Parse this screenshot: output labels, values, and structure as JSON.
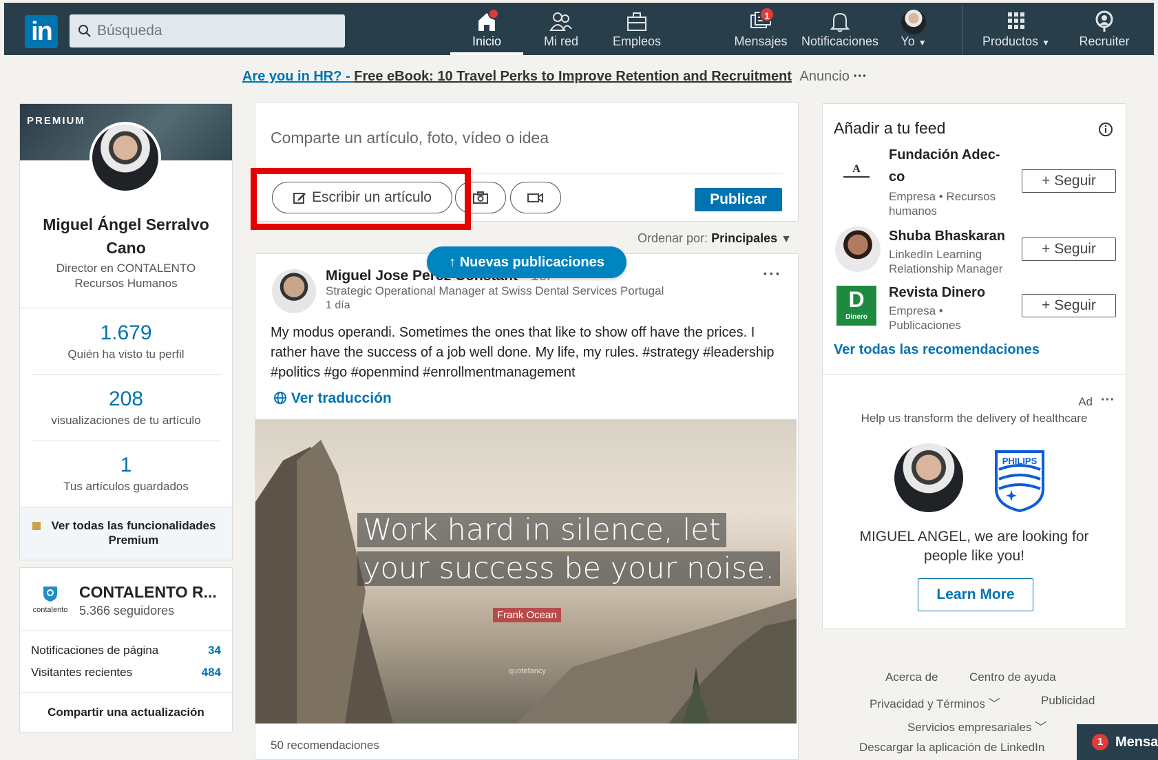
{
  "nav": {
    "logo": "in",
    "search_placeholder": "Búsqueda",
    "items": [
      {
        "label": "Inicio",
        "icon": "home-icon"
      },
      {
        "label": "Mi red",
        "icon": "network-icon"
      },
      {
        "label": "Empleos",
        "icon": "briefcase-icon"
      },
      {
        "label": "Mensajes",
        "icon": "messages-icon",
        "badge": "1"
      },
      {
        "label": "Notificaciones",
        "icon": "bell-icon"
      },
      {
        "label": "Yo",
        "icon": "avatar"
      },
      {
        "label": "Productos",
        "icon": "grid-icon"
      },
      {
        "label": "Recruiter",
        "icon": "recruiter-icon"
      }
    ]
  },
  "ad": {
    "link": "Are you in HR? - ",
    "title": "Free eBook: 10 Travel Perks to Improve Retention and Recruitment",
    "label": "Anuncio",
    "more": "···"
  },
  "profile": {
    "premium": "PREMIUM",
    "name_line1": "Miguel Ángel Serralvo",
    "name_line2": "Cano",
    "title_line1": "Director en CONTALENTO",
    "title_line2": "Recursos Humanos",
    "stats": [
      {
        "value": "1.679",
        "label": "Quién ha visto tu perfil"
      },
      {
        "value": "208",
        "label": "visualizaciones de tu artículo"
      },
      {
        "value": "1",
        "label": "Tus artículos guardados"
      }
    ],
    "premium_link_line1": "Ver todas las funcionalidades",
    "premium_link_line2": "Premium"
  },
  "company": {
    "name": "CONTALENTO R...",
    "followers": "5.366 seguidores",
    "logo_text": "contalento",
    "rows": [
      {
        "label": "Notificaciones de página",
        "value": "34"
      },
      {
        "label": "Visitantes recientes",
        "value": "484"
      }
    ],
    "share": "Compartir una actualización"
  },
  "share": {
    "placeholder": "Comparte un artículo, foto, vídeo o idea",
    "write_article": "Escribir un artículo",
    "publish": "Publicar"
  },
  "sort": {
    "label": "Ordenar por: ",
    "value": "Principales"
  },
  "new_posts": "Nuevas publicaciones",
  "post": {
    "author": "Miguel Jose Perez Constant",
    "degree": " • 1er",
    "role": "Strategic Operational Manager at Swiss Dental Services Portugal",
    "time": "1 día",
    "text": "My modus operandi. Sometimes  the ones that like to show off have the prices. I rather have the success of a job well done. My life, my rules. #strategy #leadership #politics #go #openmind #enrollmentmanagement",
    "translate": "Ver traducción",
    "quote_line1": "Work hard in silence, let",
    "quote_line2": "your success be your noise.",
    "quote_author": "Frank Ocean",
    "watermark": "quotefancy",
    "likes": "50 recomendaciones",
    "more": "···"
  },
  "feed": {
    "title": "Añadir a tu feed",
    "follow_label": "Seguir",
    "items": [
      {
        "name_line1": "Fundación Adec-",
        "name_line2": "co",
        "sub_line1": "Empresa • Recursos",
        "sub_line2": "humanos"
      },
      {
        "name_line1": "Shuba Bhaskaran",
        "sub_line1": "LinkedIn Learning",
        "sub_line2": "Relationship Manager"
      },
      {
        "name_line1": "Revista Dinero",
        "sub_line1": "Empresa •",
        "sub_line2": "Publicaciones",
        "logo_letter": "D",
        "logo_text": "Dinero"
      }
    ],
    "see_all": "Ver todas las recomendaciones"
  },
  "right_ad": {
    "label": "Ad",
    "more": "···",
    "tagline": "Help us transform the delivery of healthcare",
    "brand": "PHILIPS",
    "message_line1": "MIGUEL ANGEL, we are looking for",
    "message_line2": "people like you!",
    "cta": "Learn More"
  },
  "footer": {
    "links": [
      "Acerca de",
      "Centro de ayuda",
      "Privacidad y Términos",
      "Publicidad",
      "Servicios empresariales",
      "Descargar la aplicación de LinkedIn"
    ]
  },
  "messaging": {
    "badge": "1",
    "label": "Mensa"
  },
  "colors": {
    "nav_bg": "#283e4a",
    "accent": "#0073b1",
    "highlight": "#e60000"
  }
}
